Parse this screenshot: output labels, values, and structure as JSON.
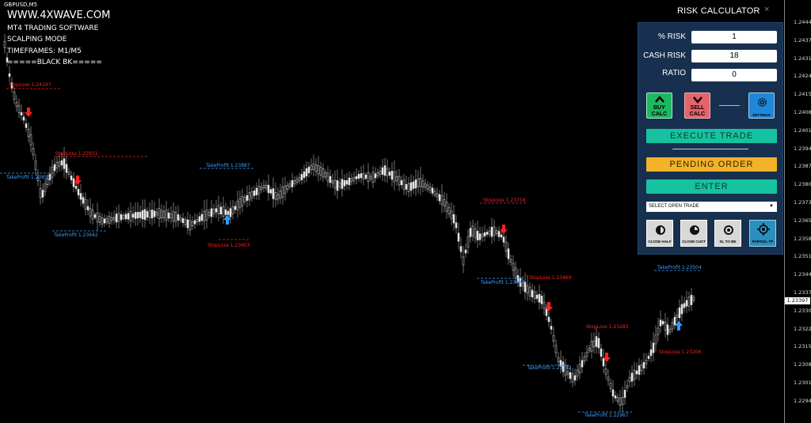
{
  "chart": {
    "symbol": "GBPUSD,M5",
    "brand": "WWW.4XWAVE.COM",
    "info_lines": [
      "MT4 TRADING SOFTWARE",
      "SCALPING MODE",
      "TIMEFRAMES: M1/M5",
      "=====BLACK BK====="
    ],
    "current_price": "1.23397",
    "price_ticks": [
      "1.24440",
      "1.24375",
      "1.24310",
      "1.24245",
      "1.24155",
      "1.24085",
      "1.24015",
      "1.23945",
      "1.23870",
      "1.23800",
      "1.23730",
      "1.23655",
      "1.23585",
      "1.23510",
      "1.23440",
      "1.23370",
      "1.23300",
      "1.23225",
      "1.23150",
      "1.23085",
      "1.23015",
      "1.22945"
    ],
    "annotations": [
      {
        "text": "StopLoss 1.24197",
        "color": "#ff2020"
      },
      {
        "text": "StopLoss 1.23931",
        "color": "#ff2020"
      },
      {
        "text": "TakeProfit 1.23855",
        "color": "#3aa0ff"
      },
      {
        "text": "TakeProfit 1.23887",
        "color": "#3aa0ff"
      },
      {
        "text": "TakeProfit 1.23642",
        "color": "#3aa0ff"
      },
      {
        "text": "StopLoss 1.23603",
        "color": "#ff2020"
      },
      {
        "text": "StopLoss 1.23758",
        "color": "#ff2020"
      },
      {
        "text": "StopLoss 1.23469",
        "color": "#ff2020"
      },
      {
        "text": "TakeProfit 1.23443",
        "color": "#3aa0ff"
      },
      {
        "text": "TakeProfit 1.23504",
        "color": "#3aa0ff"
      },
      {
        "text": "StopLoss 1.23283",
        "color": "#ff2020"
      },
      {
        "text": "StopLoss 1.23206",
        "color": "#ff2020"
      },
      {
        "text": "TakeProfit 1.23142",
        "color": "#3aa0ff"
      },
      {
        "text": "TakeProfit 1.22967",
        "color": "#3aa0ff"
      }
    ]
  },
  "panel": {
    "title": "RISK CALCULATOR",
    "close_icon": "×",
    "risk_label": "% RISK",
    "risk_value": "1",
    "cash_label": "CASH RISK",
    "cash_value": "18",
    "ratio_label": "RATIO",
    "ratio_value": "0",
    "buy_line1": "BUY",
    "buy_line2": "CALC",
    "sell_line1": "SELL",
    "sell_line2": "CALC",
    "settings_label": "SETTINGS",
    "execute_label": "EXECUTE TRADE",
    "pending_label": "PENDING ORDER",
    "enter_label": "ENTER",
    "select_label": "SELECT OPEN TRADE",
    "close_half": "CLOSE HALF",
    "close_cust": "CLOSE CUST",
    "sl_to_be": "SL TO BE",
    "partial_tp": "PARTIAL TP",
    "colors": {
      "buy": "#1db861",
      "sell": "#e5636b",
      "settings": "#1f88d8",
      "execute": "#15c3a0",
      "pending": "#f2b329",
      "enter": "#15c3a0"
    }
  }
}
